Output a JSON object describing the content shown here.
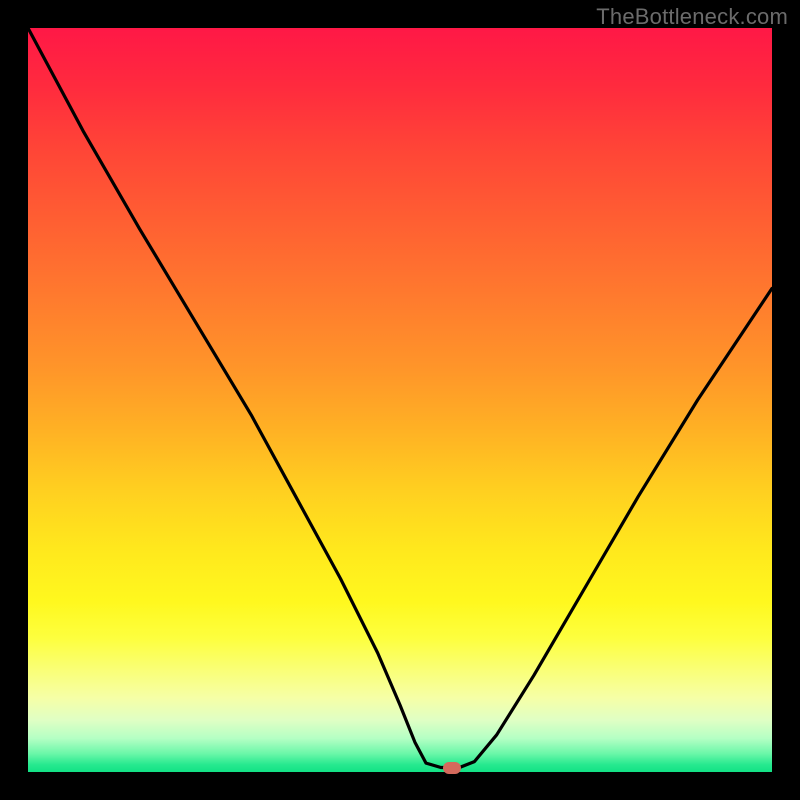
{
  "watermark": "TheBottleneck.com",
  "chart_data": {
    "type": "line",
    "title": "",
    "xlabel": "",
    "ylabel": "",
    "x_range_percent": [
      0,
      100
    ],
    "y_range_percent": [
      0,
      100
    ],
    "note": "Single black curve on a vertical rainbow gradient (red top → green bottom). No axis ticks or numeric labels are rendered; values below are positions expressed as percent of the plot area (x left→right, y as height above bottom). A small rounded red marker is placed at the curve's minimum.",
    "series": [
      {
        "name": "bottleneck-curve",
        "points_percent": [
          {
            "x": 0.0,
            "y": 100
          },
          {
            "x": 7.5,
            "y": 86.0
          },
          {
            "x": 15.0,
            "y": 73.0
          },
          {
            "x": 22.5,
            "y": 60.5
          },
          {
            "x": 30.0,
            "y": 48.0
          },
          {
            "x": 36.0,
            "y": 37.0
          },
          {
            "x": 42.0,
            "y": 26.0
          },
          {
            "x": 47.0,
            "y": 16.0
          },
          {
            "x": 50.0,
            "y": 9.0
          },
          {
            "x": 52.0,
            "y": 4.0
          },
          {
            "x": 53.5,
            "y": 1.2
          },
          {
            "x": 55.5,
            "y": 0.6
          },
          {
            "x": 58.0,
            "y": 0.6
          },
          {
            "x": 60.0,
            "y": 1.4
          },
          {
            "x": 63.0,
            "y": 5.0
          },
          {
            "x": 68.0,
            "y": 13.0
          },
          {
            "x": 75.0,
            "y": 25.0
          },
          {
            "x": 82.0,
            "y": 37.0
          },
          {
            "x": 90.0,
            "y": 50.0
          },
          {
            "x": 100.0,
            "y": 65.0
          }
        ]
      }
    ],
    "marker": {
      "x_percent": 57.0,
      "y_percent": 0.6,
      "color": "#d4695c"
    },
    "gradient_stops": [
      {
        "pos": 0,
        "color": "#ff1846"
      },
      {
        "pos": 50,
        "color": "#ff9629"
      },
      {
        "pos": 80,
        "color": "#fff81e"
      },
      {
        "pos": 100,
        "color": "#12e285"
      }
    ]
  }
}
